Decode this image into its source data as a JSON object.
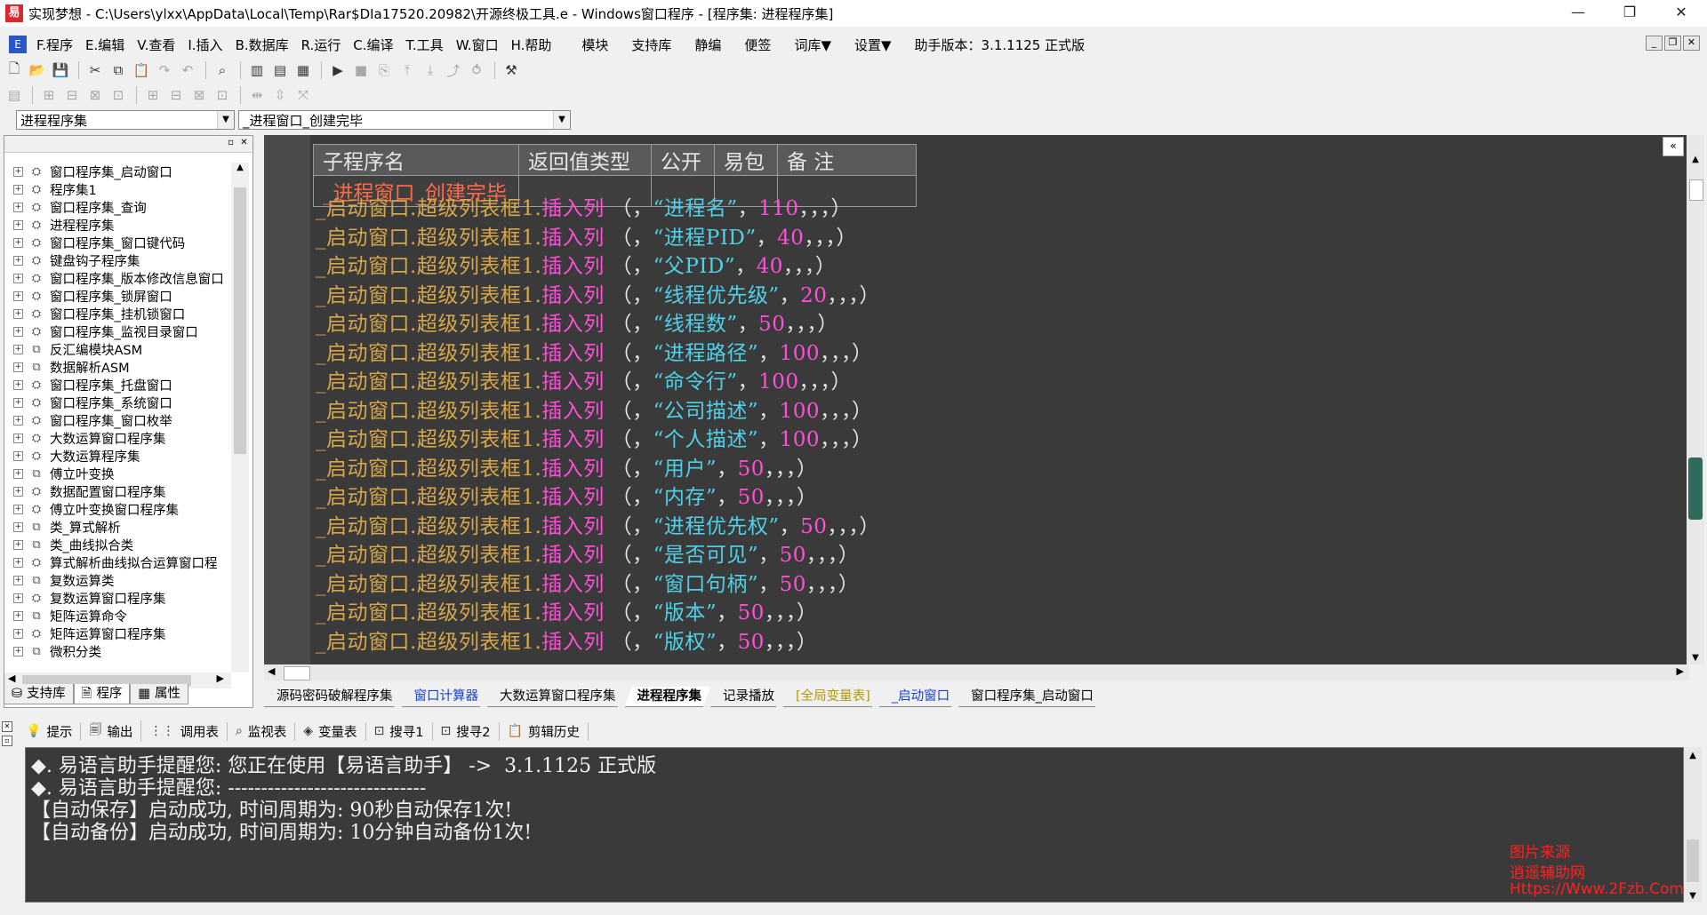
{
  "window": {
    "title": "实现梦想 - C:\\Users\\ylxx\\AppData\\Local\\Temp\\Rar$DIa17520.20982\\开源终极工具.e - Windows窗口程序 - [程序集: 进程程序集]",
    "controls": [
      "—",
      "❐",
      "✕"
    ]
  },
  "menu": {
    "items": [
      "F.程序",
      "E.编辑",
      "V.查看",
      "I.插入",
      "B.数据库",
      "R.运行",
      "C.编译",
      "T.工具",
      "W.窗口",
      "H.帮助"
    ],
    "extras": [
      "模块",
      "支持库",
      "静编",
      "便签",
      "词库▼",
      "设置▼",
      "助手版本：3.1.1125 正式版"
    ],
    "mdi_controls": [
      "_",
      "❐",
      "✕"
    ]
  },
  "toolbar1": {
    "icons": [
      "new-file-icon",
      "open-folder-icon",
      "save-icon",
      "cut-icon",
      "copy-icon",
      "paste-icon",
      "redo-icon",
      "undo-icon",
      "find-icon",
      "layout-1-icon",
      "layout-2-icon",
      "layout-3-icon",
      "run-icon",
      "stop-icon",
      "step-icon",
      "step-into-icon",
      "step-over-icon",
      "step-out-icon",
      "run-to-cursor-icon",
      "debug-tool-icon"
    ],
    "glyphs": [
      "🗋",
      "📂",
      "💾",
      "✂",
      "⧉",
      "📋",
      "↷",
      "↶",
      "⌕",
      "▥",
      "▤",
      "▦",
      "▶",
      "■",
      "⎘",
      "⤒",
      "⤓",
      "⤴",
      "⥀",
      "⚒"
    ]
  },
  "toolbar2": {
    "icons": [
      "align-1-icon",
      "align-2-icon",
      "align-3-icon",
      "align-4-icon",
      "align-5-icon",
      "align-6-icon",
      "align-7-icon",
      "align-8-icon",
      "align-9-icon",
      "space-h-icon",
      "space-v-icon",
      "space-both-icon"
    ],
    "glyphs": [
      "▤",
      "⊞",
      "⊟",
      "⊠",
      "⊡",
      "⊞",
      "⊟",
      "⊠",
      "⊡",
      "⇹",
      "⇳",
      "⤧"
    ]
  },
  "combos": {
    "left": "进程程序集",
    "right": "_进程窗口_创建完毕"
  },
  "tree": {
    "items": [
      {
        "label": "窗口程序集_启动窗口",
        "icon": "⛭"
      },
      {
        "label": "程序集1",
        "icon": "⛭"
      },
      {
        "label": "窗口程序集_查询",
        "icon": "⛭"
      },
      {
        "label": "进程程序集",
        "icon": "⛭"
      },
      {
        "label": "窗口程序集_窗口键代码",
        "icon": "⛭"
      },
      {
        "label": "键盘钩子程序集",
        "icon": "⛭"
      },
      {
        "label": "窗口程序集_版本修改信息窗口",
        "icon": "⛭"
      },
      {
        "label": "窗口程序集_锁屏窗口",
        "icon": "⛭"
      },
      {
        "label": "窗口程序集_挂机锁窗口",
        "icon": "⛭"
      },
      {
        "label": "窗口程序集_监视目录窗口",
        "icon": "⛭"
      },
      {
        "label": "反汇编模块ASM",
        "icon": "⧉"
      },
      {
        "label": "数据解析ASM",
        "icon": "⧉"
      },
      {
        "label": "窗口程序集_托盘窗口",
        "icon": "⛭"
      },
      {
        "label": "窗口程序集_系统窗口",
        "icon": "⛭"
      },
      {
        "label": "窗口程序集_窗口枚举",
        "icon": "⛭"
      },
      {
        "label": "大数运算窗口程序集",
        "icon": "⛭"
      },
      {
        "label": "大数运算程序集",
        "icon": "⛭"
      },
      {
        "label": "傅立叶变换",
        "icon": "⧉"
      },
      {
        "label": "数据配置窗口程序集",
        "icon": "⛭"
      },
      {
        "label": "傅立叶变换窗口程序集",
        "icon": "⛭"
      },
      {
        "label": "类_算式解析",
        "icon": "⧉"
      },
      {
        "label": "类_曲线拟合类",
        "icon": "⧉"
      },
      {
        "label": "算式解析曲线拟合运算窗口程",
        "icon": "⛭"
      },
      {
        "label": "复数运算类",
        "icon": "⧉"
      },
      {
        "label": "复数运算窗口程序集",
        "icon": "⛭"
      },
      {
        "label": "矩阵运算命令",
        "icon": "⧉"
      },
      {
        "label": "矩阵运算窗口程序集",
        "icon": "⛭"
      },
      {
        "label": "微积分类",
        "icon": "⧉"
      }
    ]
  },
  "left_tabs": [
    {
      "label": "支持库",
      "icon": "⛁"
    },
    {
      "label": "程序",
      "icon": "🗎"
    },
    {
      "label": "属性",
      "icon": "▦"
    }
  ],
  "sub_table": {
    "headers": [
      "子程序名",
      "返回值类型",
      "公开",
      "易包",
      "备 注"
    ],
    "row": [
      "_进程窗口_创建完毕",
      "",
      "",
      "",
      ""
    ]
  },
  "code": {
    "object": "_启动窗口",
    "control": "超级列表框1",
    "method": "插入列",
    "lines": [
      {
        "text": "进程名",
        "num": "110"
      },
      {
        "text": "进程PID",
        "num": "40"
      },
      {
        "text": "父PID",
        "num": "40"
      },
      {
        "text": "线程优先级",
        "num": "20"
      },
      {
        "text": "线程数",
        "num": "50"
      },
      {
        "text": "进程路径",
        "num": "100"
      },
      {
        "text": "命令行",
        "num": "100"
      },
      {
        "text": "公司描述",
        "num": "100"
      },
      {
        "text": "个人描述",
        "num": "100"
      },
      {
        "text": "用户",
        "num": "50"
      },
      {
        "text": "内存",
        "num": "50"
      },
      {
        "text": "进程优先权",
        "num": "50"
      },
      {
        "text": "是否可见",
        "num": "50"
      },
      {
        "text": "窗口句柄",
        "num": "50"
      },
      {
        "text": "版本",
        "num": "50"
      },
      {
        "text": "版权",
        "num": "50"
      }
    ]
  },
  "editor_tabs": [
    {
      "label": "源码密码破解程序集",
      "style": ""
    },
    {
      "label": "窗口计算器",
      "style": "blue"
    },
    {
      "label": "大数运算窗口程序集",
      "style": ""
    },
    {
      "label": "进程程序集",
      "style": "active"
    },
    {
      "label": "记录播放",
      "style": ""
    },
    {
      "label": "[全局变量表]",
      "style": "yellow"
    },
    {
      "label": "_启动窗口",
      "style": "blue"
    },
    {
      "label": "窗口程序集_启动窗口",
      "style": ""
    }
  ],
  "bottom_tabs": [
    {
      "label": "提示",
      "icon": "💡"
    },
    {
      "label": "输出",
      "icon": "🗐"
    },
    {
      "label": "调用表",
      "icon": "⋮⋮"
    },
    {
      "label": "监视表",
      "icon": "⌕"
    },
    {
      "label": "变量表",
      "icon": "◈"
    },
    {
      "label": "搜寻1",
      "icon": "⊡"
    },
    {
      "label": "搜寻2",
      "icon": "⊡"
    },
    {
      "label": "剪辑历史",
      "icon": "📋"
    }
  ],
  "output": {
    "lines": [
      "◆. 易语言助手提醒您: 您正在使用【易语言助手】 ->  3.1.1125 正式版",
      "◆. 易语言助手提醒您: ------------------------------",
      "【自动保存】启动成功, 时间周期为: 90秒自动保存1次!",
      "【自动备份】启动成功, 时间周期为: 10分钟自动备份1次!"
    ]
  },
  "watermark": [
    "图片来源",
    "逍遥辅助网",
    "Https://Www.2Fzb.Com"
  ]
}
